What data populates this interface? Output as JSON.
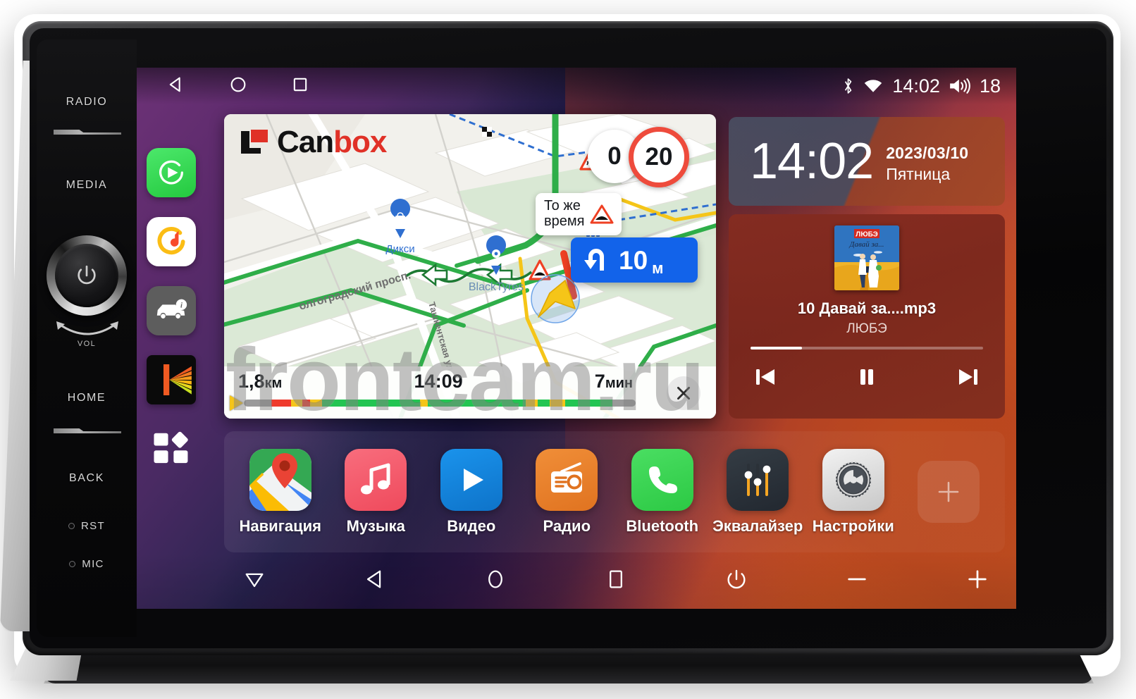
{
  "device": {
    "side_controls": [
      {
        "label": "RADIO",
        "name": "radio-hardkey"
      },
      {
        "label": "MEDIA",
        "name": "media-hardkey"
      },
      {
        "label": "VOL",
        "name": "volume-knob-label"
      },
      {
        "label": "HOME",
        "name": "home-hardkey"
      },
      {
        "label": "BACK",
        "name": "back-hardkey"
      },
      {
        "label": "RST",
        "name": "reset-pinhole"
      },
      {
        "label": "MIC",
        "name": "microphone-pinhole"
      }
    ]
  },
  "statusbar": {
    "bluetooth_icon": "bluetooth-icon",
    "wifi_icon": "wifi-icon",
    "time": "14:02",
    "volume_icon": "volume-icon",
    "volume_level": "18",
    "nav": [
      {
        "icon": "back-icon",
        "name": "statusbar-back-button"
      },
      {
        "icon": "home-icon",
        "name": "statusbar-home-button"
      },
      {
        "icon": "recents-icon",
        "name": "statusbar-recents-button"
      }
    ]
  },
  "rail": [
    {
      "name": "rail-item-carplay",
      "icon": "play-circle-icon",
      "bg": "#2fd44e"
    },
    {
      "name": "rail-item-yandex-music",
      "icon": "yandex-music-icon",
      "bg": "#ffffff"
    },
    {
      "name": "rail-item-car-info",
      "icon": "car-info-icon",
      "bg": "#5a5a5a"
    },
    {
      "name": "rail-item-kaspersky",
      "icon": "burst-k-icon",
      "bg": "#0a0a0a"
    },
    {
      "name": "rail-item-all-apps",
      "icon": "app-grid-icon",
      "bg": "transparent"
    }
  ],
  "navigation": {
    "brand": {
      "part1": "Can",
      "part2": "box",
      "logo": "canbox-logo-icon"
    },
    "current_speed": "0",
    "speed_limit": "20",
    "tooltip": {
      "line1": "То же",
      "line2": "время",
      "icon": "speed-bump-warning-icon"
    },
    "maneuver": {
      "icon": "u-turn-left-icon",
      "distance": "10",
      "unit": "м"
    },
    "footer": {
      "distance": "1,8",
      "distance_unit": "км",
      "eta": "14:09",
      "duration": "7",
      "duration_unit": "мин"
    },
    "close_icon": "close-icon",
    "map_labels": [
      {
        "text": "Дикси",
        "name": "map-poi-dixy"
      },
      {
        "text": "Волгоградский просп.",
        "name": "map-street-volgogradsky"
      },
      {
        "text": "Ташкентская ул.",
        "name": "map-street-tashkentskaya"
      },
      {
        "text": "BlackTyres",
        "name": "map-poi-blacktyres"
      }
    ],
    "traffic_segments": [
      {
        "color": "#9a9a9a",
        "w": 7
      },
      {
        "color": "#ef3b2c",
        "w": 5
      },
      {
        "color": "#f5c518",
        "w": 3
      },
      {
        "color": "#ef3b2c",
        "w": 2
      },
      {
        "color": "#f5c518",
        "w": 3
      },
      {
        "color": "#23c552",
        "w": 25
      },
      {
        "color": "#f5c518",
        "w": 2
      },
      {
        "color": "#23c552",
        "w": 25
      },
      {
        "color": "#f5c518",
        "w": 3
      },
      {
        "color": "#23c552",
        "w": 3
      },
      {
        "color": "#f5c518",
        "w": 4
      },
      {
        "color": "#23c552",
        "w": 12
      },
      {
        "color": "#9a9a9a",
        "w": 6
      }
    ]
  },
  "clock_widget": {
    "time": "14:02",
    "date": "2023/03/10",
    "weekday": "Пятница"
  },
  "music_widget": {
    "album_art_name": "album-art-lyube",
    "album_badge": "ЛЮБЭ",
    "track": "10 Давай за....mp3",
    "artist": "ЛЮБЭ",
    "progress_percent": 22,
    "controls": [
      {
        "name": "previous-track-button",
        "icon": "skip-previous-icon"
      },
      {
        "name": "pause-button",
        "icon": "pause-icon"
      },
      {
        "name": "next-track-button",
        "icon": "skip-next-icon"
      }
    ]
  },
  "dock": [
    {
      "label": "Навигация",
      "name": "dock-app-navigation",
      "icon": "maps-icon",
      "bg": "#34a853"
    },
    {
      "label": "Музыка",
      "name": "dock-app-music",
      "icon": "music-note-icon",
      "bg": "#f3596a"
    },
    {
      "label": "Видео",
      "name": "dock-app-video",
      "icon": "play-icon",
      "bg": "#1183dd"
    },
    {
      "label": "Радио",
      "name": "dock-app-radio",
      "icon": "radio-icon",
      "bg": "#e8822b"
    },
    {
      "label": "Bluetooth",
      "name": "dock-app-bluetooth",
      "icon": "phone-icon",
      "bg": "#38d353"
    },
    {
      "label": "Эквалайзер",
      "name": "dock-app-equalizer",
      "icon": "sliders-icon",
      "bg": "#2b3138"
    },
    {
      "label": "Настройки",
      "name": "dock-app-settings",
      "icon": "gear-icon",
      "bg": "#d9d9d9"
    }
  ],
  "dock_add": {
    "icon": "plus-icon",
    "name": "dock-add-shortcut-button"
  },
  "softnav": [
    {
      "name": "softnav-collapse-button",
      "icon": "triangle-down-icon"
    },
    {
      "name": "softnav-back-button",
      "icon": "back-icon"
    },
    {
      "name": "softnav-home-button",
      "icon": "home-icon"
    },
    {
      "name": "softnav-recents-button",
      "icon": "recents-icon"
    },
    {
      "name": "softnav-power-button",
      "icon": "power-icon"
    },
    {
      "name": "softnav-volume-down-button",
      "icon": "minus-icon"
    },
    {
      "name": "softnav-volume-up-button",
      "icon": "plus-icon"
    }
  ],
  "watermark": "frontcam.ru"
}
